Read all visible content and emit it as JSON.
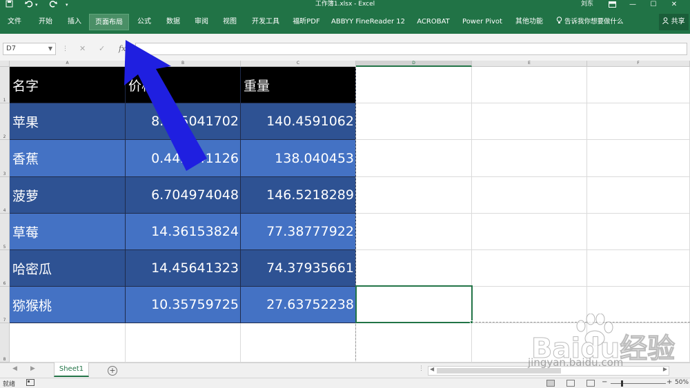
{
  "titlebar": {
    "title": "工作簿1.xlsx - Excel",
    "user": "刘东",
    "quick_access": {
      "save_icon": "save-icon",
      "undo_icon": "undo-icon",
      "redo_icon": "redo-icon",
      "more_icon": "customize-icon"
    },
    "window_buttons": [
      "ribbon-display-icon",
      "minimize-icon",
      "maximize-icon",
      "close-icon"
    ]
  },
  "ribbon": {
    "tabs": [
      {
        "label": "文件"
      },
      {
        "label": "开始"
      },
      {
        "label": "插入"
      },
      {
        "label": "页面布局",
        "active": true
      },
      {
        "label": "公式"
      },
      {
        "label": "数据"
      },
      {
        "label": "审阅"
      },
      {
        "label": "视图"
      },
      {
        "label": "开发工具"
      },
      {
        "label": "福昕PDF"
      },
      {
        "label": "ABBYY FineReader 12"
      },
      {
        "label": "ACROBAT"
      },
      {
        "label": "Power Pivot"
      },
      {
        "label": "其他功能"
      }
    ],
    "tell_me": "告诉我你想要做什么",
    "share": "共享"
  },
  "formula_bar": {
    "name_box": "D7",
    "fx": "fx",
    "value": ""
  },
  "grid": {
    "column_headers": [
      "A",
      "B",
      "C",
      "D",
      "E",
      "F"
    ],
    "row_headers": [
      "1",
      "2",
      "3",
      "4",
      "5",
      "6",
      "7",
      "8"
    ],
    "table": {
      "headers": [
        "名字",
        "价格",
        "重量"
      ],
      "rows": [
        {
          "name": "苹果",
          "price": "8.425041702",
          "weight": "140.4591062"
        },
        {
          "name": "香蕉",
          "price": "0.442241126",
          "weight": "138.040453"
        },
        {
          "name": "菠萝",
          "price": "6.704974048",
          "weight": "146.5218289"
        },
        {
          "name": "草莓",
          "price": "14.36153824",
          "weight": "77.38777922"
        },
        {
          "name": "哈密瓜",
          "price": "14.45641323",
          "weight": "74.37935661"
        },
        {
          "name": "猕猴桃",
          "price": "10.35759725",
          "weight": "27.63752238"
        }
      ]
    },
    "selected_cell": "D7"
  },
  "sheet_tabs": {
    "tabs": [
      "Sheet1"
    ],
    "add_icon": "add-sheet-icon"
  },
  "statusbar": {
    "ready": "就绪",
    "zoom": "50%"
  },
  "watermark": {
    "text": "Baidu经验",
    "url": "jingyan.baidu.com"
  },
  "colors": {
    "excel_green": "#217346",
    "header_fill": "#000000",
    "band_dark": "#2e5293",
    "band_light": "#4472c4",
    "annotation_arrow": "#1f1fe0"
  }
}
